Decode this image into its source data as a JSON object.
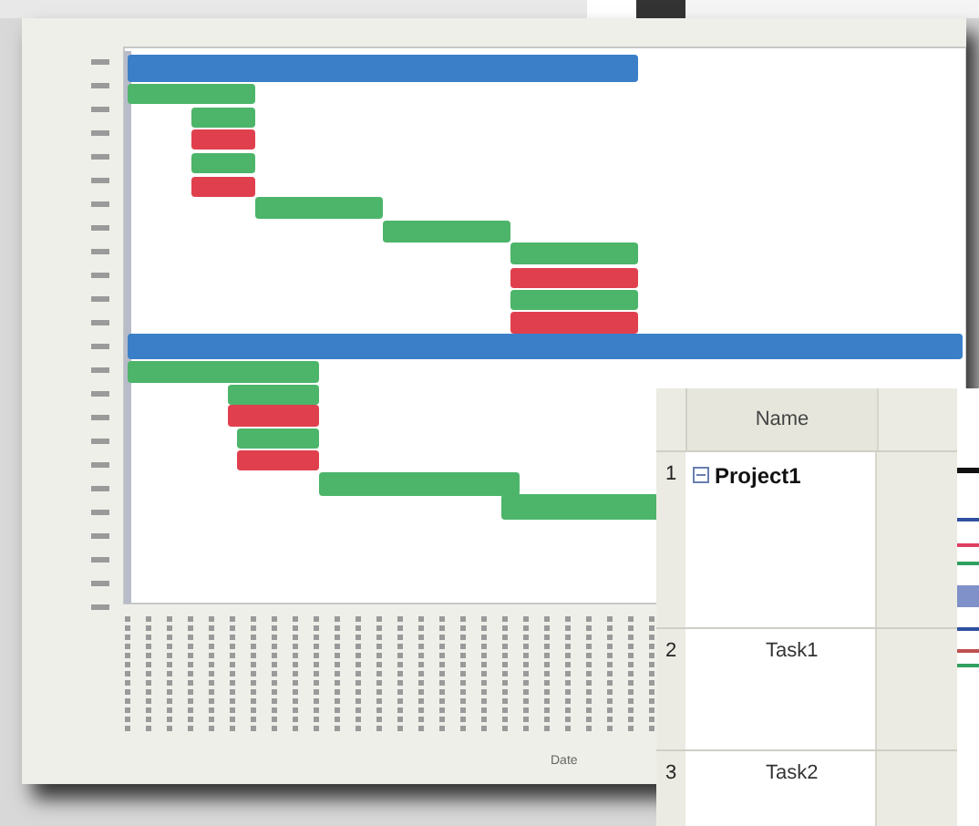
{
  "chart_window": {
    "x_axis_title": "Date"
  },
  "task_grid": {
    "columns": [
      "Name"
    ],
    "rows": [
      {
        "number": "1",
        "name": "Project1",
        "kind": "summary",
        "expanded": true
      },
      {
        "number": "2",
        "name": "Task1",
        "kind": "task"
      },
      {
        "number": "3",
        "name": "Task2",
        "kind": "task"
      }
    ]
  }
}
